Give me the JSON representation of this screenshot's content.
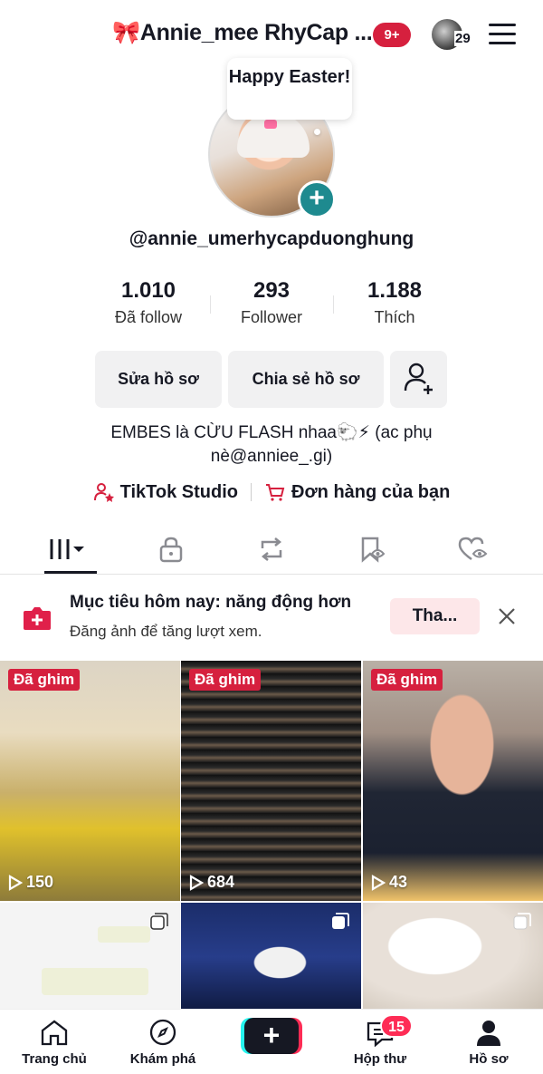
{
  "header": {
    "title": "🎀Annie_mee RhyCap ...",
    "notification_badge": "9+",
    "avatar_count": "29"
  },
  "profile": {
    "bubble_text": "Happy Easter!",
    "username": "@annie_umerhycapduonghung",
    "stats": [
      {
        "value": "1.010",
        "label": "Đã follow"
      },
      {
        "value": "293",
        "label": "Follower"
      },
      {
        "value": "1.188",
        "label": "Thích"
      }
    ],
    "edit_label": "Sửa hồ sơ",
    "share_label": "Chia sẻ hồ sơ",
    "bio_line1": "EMBES là CỪU FLASH nhaa🐑⚡ (ac phụ",
    "bio_line2": "nè@anniee_.gi)",
    "studio_label": "TikTok Studio",
    "orders_label": "Đơn hàng của bạn"
  },
  "goal": {
    "title": "Mục tiêu hôm nay: năng động hơn",
    "subtitle": "Đăng ảnh để tăng lượt xem.",
    "button_label": "Tha..."
  },
  "videos": [
    {
      "pinned": "Đã ghim",
      "views": "150"
    },
    {
      "pinned": "Đã ghim",
      "views": "684"
    },
    {
      "pinned": "Đã ghim",
      "views": "43"
    }
  ],
  "nav": {
    "home": "Trang chủ",
    "explore": "Khám phá",
    "inbox": "Hộp thư",
    "inbox_badge": "15",
    "profile": "Hồ sơ"
  },
  "colors": {
    "accent_red": "#d6203e",
    "tiktok_pink": "#fe2c55",
    "teal": "#1e8a8f"
  }
}
